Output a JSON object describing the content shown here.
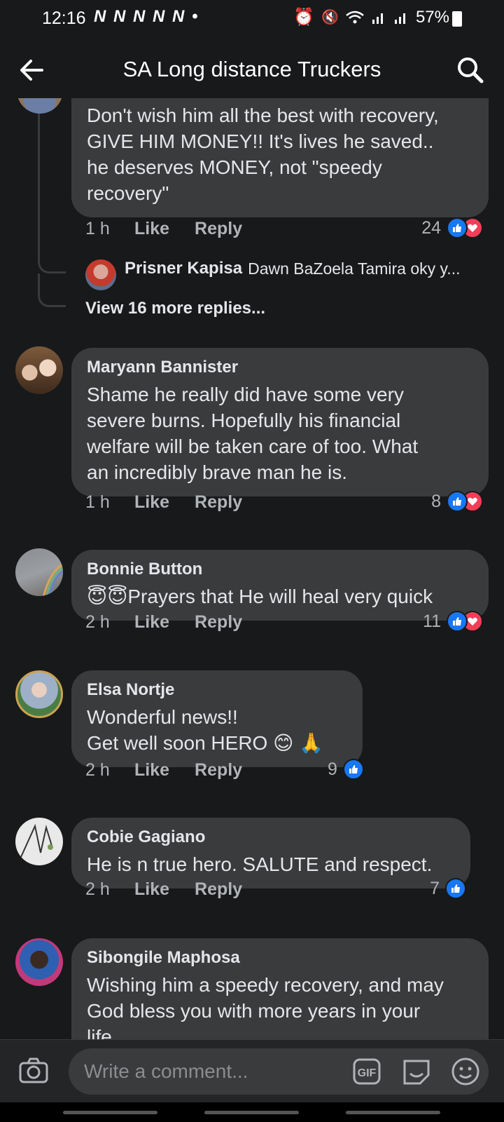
{
  "status_bar": {
    "time": "12:16",
    "notifications": "N N N N N •",
    "battery": "57%"
  },
  "header": {
    "title": "SA Long distance Truckers"
  },
  "comments": [
    {
      "text": "Don't wish him all the best with recovery,\nGIVE HIM MONEY!! It's lives he saved..\nhe deserves MONEY, not \"speedy\nrecovery\"",
      "time": "1 h",
      "like_label": "Like",
      "reply_label": "Reply",
      "reaction_count": "24",
      "reactions": [
        "like",
        "love"
      ]
    },
    {
      "author": "Maryann Bannister",
      "text": "Shame he really did have some very\nsevere burns. Hopefully his financial\nwelfare will be taken care of too. What\nan incredibly brave man he is.",
      "time": "1 h",
      "like_label": "Like",
      "reply_label": "Reply",
      "reaction_count": "8",
      "reactions": [
        "like",
        "love"
      ]
    },
    {
      "author": "Bonnie Button",
      "text": "😇😇Prayers that He will heal very quick",
      "time": "2 h",
      "like_label": "Like",
      "reply_label": "Reply",
      "reaction_count": "11",
      "reactions": [
        "like",
        "love"
      ]
    },
    {
      "author": "Elsa Nortje",
      "text": "Wonderful news!!\nGet well soon  HERO 😊 🙏",
      "time": "2 h",
      "like_label": "Like",
      "reply_label": "Reply",
      "reaction_count": "9",
      "reactions": [
        "like"
      ]
    },
    {
      "author": "Cobie Gagiano",
      "text": "He is n true hero. SALUTE and respect.",
      "time": "2 h",
      "like_label": "Like",
      "reply_label": "Reply",
      "reaction_count": "7",
      "reactions": [
        "like"
      ]
    },
    {
      "author": "Sibongile Maphosa",
      "text": "Wishing him a speedy recovery, and may\nGod  bless you with more years in your\nlife"
    }
  ],
  "reply_preview": {
    "author": "Prisner Kapisa",
    "snippet": "Dawn BaZoela Tamira oky y..."
  },
  "view_more": "View 16 more replies...",
  "composer": {
    "placeholder": "Write a comment..."
  },
  "colors": {
    "background": "#18191a",
    "bubble": "#3a3b3c",
    "like": "#1877f2",
    "love": "#f33e58"
  }
}
